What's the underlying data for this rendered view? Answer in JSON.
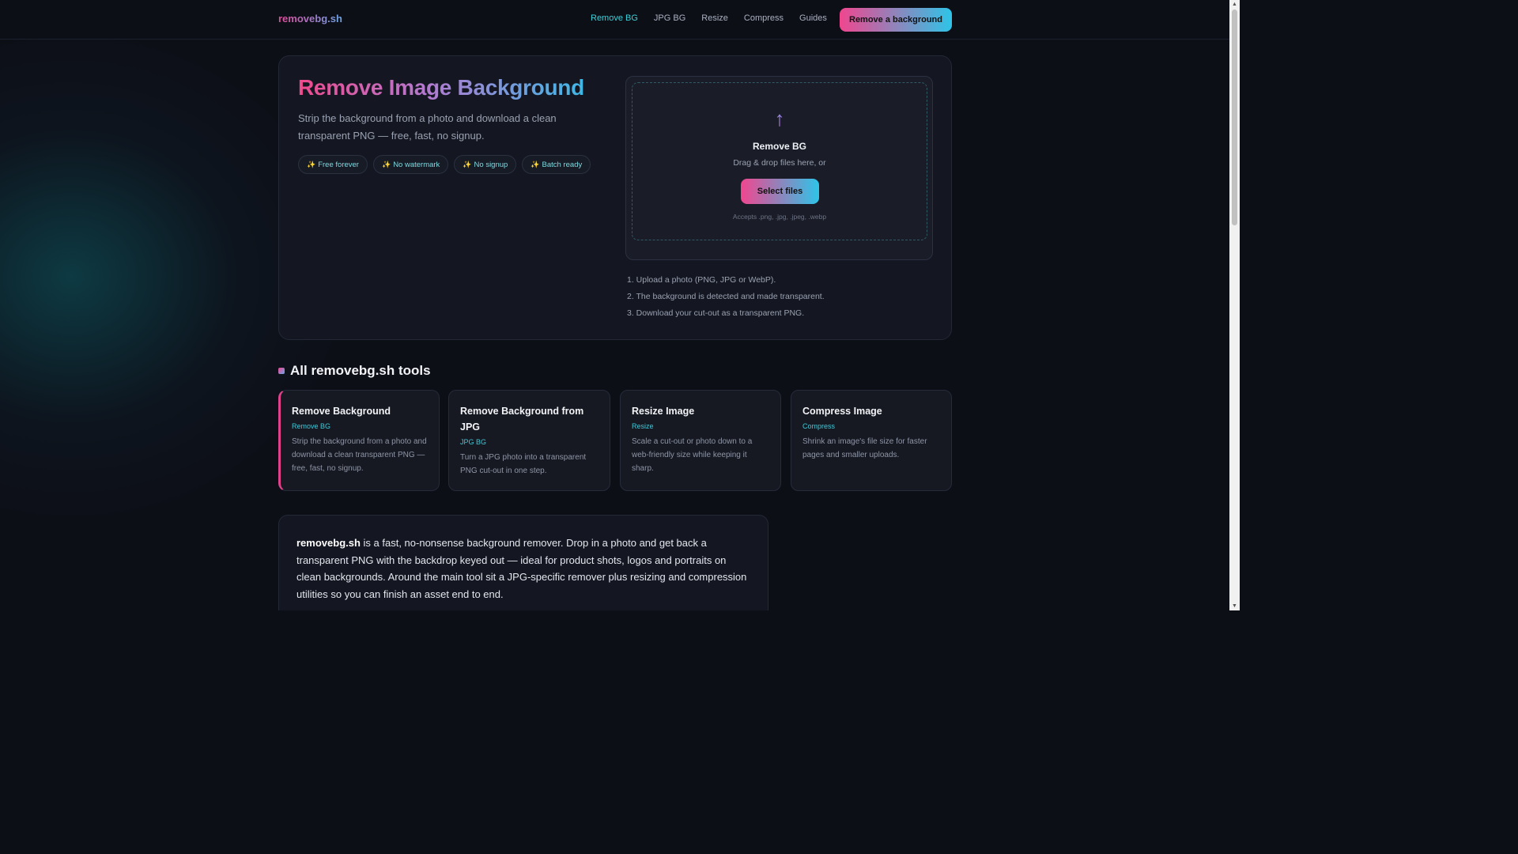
{
  "header": {
    "brand": "removebg.sh",
    "nav": [
      "Remove BG",
      "JPG BG",
      "Resize",
      "Compress",
      "Guides"
    ],
    "cta": "Remove a background"
  },
  "hero": {
    "title": "Remove Image Background",
    "subtitle": "Strip the background from a photo and download a clean transparent PNG — free, fast, no signup.",
    "chips": [
      "Free forever",
      "No watermark",
      "No signup",
      "Batch ready"
    ],
    "chip_icon": "✨",
    "upload": {
      "icon": "↑",
      "title": "Remove BG",
      "text": "Drag & drop files here, or",
      "button": "Select files",
      "accepts": "Accepts .png, .jpg, .jpeg, .webp"
    },
    "steps": [
      "1. Upload a photo (PNG, JPG or WebP).",
      "2. The background is detected and made transparent.",
      "3. Download your cut-out as a transparent PNG."
    ]
  },
  "tools": {
    "title": "All removebg.sh tools",
    "items": [
      {
        "title": "Remove Background",
        "tag": "Remove BG",
        "desc": "Strip the background from a photo and download a clean transparent PNG — free, fast, no signup."
      },
      {
        "title": "Remove Background from JPG",
        "tag": "JPG BG",
        "desc": "Turn a JPG photo into a transparent PNG cut-out in one step."
      },
      {
        "title": "Resize Image",
        "tag": "Resize",
        "desc": "Scale a cut-out or photo down to a web-friendly size while keeping it sharp."
      },
      {
        "title": "Compress Image",
        "tag": "Compress",
        "desc": "Shrink an image's file size for faster pages and smaller uploads."
      }
    ]
  },
  "about": {
    "brand": "removebg.sh",
    "text": " is a fast, no-nonsense background remover. Drop in a photo and get back a transparent PNG with the backdrop keyed out — ideal for product shots, logos and portraits on clean backgrounds. Around the main tool sit a JPG-specific remover plus resizing and compression utilities so you can finish an asset end to end."
  },
  "colors": {
    "accent_pink": "#f0468f",
    "accent_cyan": "#2ec4e8",
    "background": "#0d0f17"
  }
}
